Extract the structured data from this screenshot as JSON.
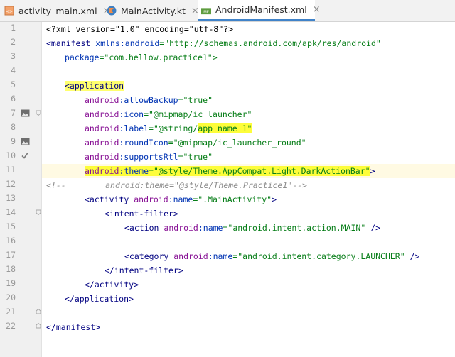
{
  "tabs": [
    {
      "label": "activity_main.xml",
      "icon": "xml-file-icon",
      "active": false
    },
    {
      "label": "MainActivity.kt",
      "icon": "kotlin-file-icon",
      "active": false
    },
    {
      "label": "AndroidManifest.xml",
      "icon": "manifest-file-icon",
      "active": true
    }
  ],
  "close_glyph": "×",
  "line_numbers": [
    "1",
    "2",
    "3",
    "4",
    "5",
    "6",
    "7",
    "8",
    "9",
    "10",
    "11",
    "12",
    "13",
    "14",
    "15",
    "16",
    "17",
    "18",
    "19",
    "20",
    "21",
    "22"
  ],
  "code": {
    "l1": "<?xml version=\"1.0\" encoding=\"utf-8\"?>",
    "l2_open": "<manifest",
    "l2_attr": " xmlns:android",
    "l2_val": "=\"http://schemas.android.com/apk/res/android\"",
    "l3_attr": "package",
    "l3_val": "=\"com.hellow.practice1\">",
    "l5_tag": "<application",
    "l6_ns": "android",
    "l6_attr": ":allowBackup",
    "l6_val": "=\"true\"",
    "l7_ns": "android",
    "l7_attr": ":icon",
    "l7_val": "=\"@mipmap/ic_launcher\"",
    "l8_ns": "android",
    "l8_attr": ":label",
    "l8_val_a": "=\"@string/",
    "l8_val_b": "app_name_1",
    "l8_val_c": "\"",
    "l9_ns": "android",
    "l9_attr": ":roundIcon",
    "l9_val": "=\"@mipmap/ic_launcher_round\"",
    "l10_ns": "android",
    "l10_attr": ":supportsRtl",
    "l10_val": "=\"true\"",
    "l11_ns": "android",
    "l11_attr": ":theme",
    "l11_val_a": "=\"@style/Theme.AppCompat",
    "l11_val_b": ".Light.DarkActionBar\"",
    "l11_end": ">",
    "l12_open": "<!--",
    "l12_body": "        android:theme=\"@style/Theme.Practice1\"-->",
    "l13_tag": "<activity",
    "l13_ns": " android",
    "l13_attr": ":name",
    "l13_val": "=\".MainActivity\"",
    "l13_end": ">",
    "l14": "<intent-filter>",
    "l15_tag": "<action",
    "l15_ns": " android",
    "l15_attr": ":name",
    "l15_val": "=\"android.intent.action.MAIN\"",
    "l15_end": " />",
    "l17_tag": "<category",
    "l17_ns": " android",
    "l17_attr": ":name",
    "l17_val": "=\"android.intent.category.LAUNCHER\"",
    "l17_end": " />",
    "l18": "</intent-filter>",
    "l19": "</activity>",
    "l20": "</application>",
    "l22": "</manifest>"
  },
  "colors": {
    "tag": "#000080",
    "namespace": "#871094",
    "attribute": "#0033b3",
    "value": "#067d17",
    "highlight": "#fdfd3a",
    "active_tab_underline": "#4083c9"
  }
}
